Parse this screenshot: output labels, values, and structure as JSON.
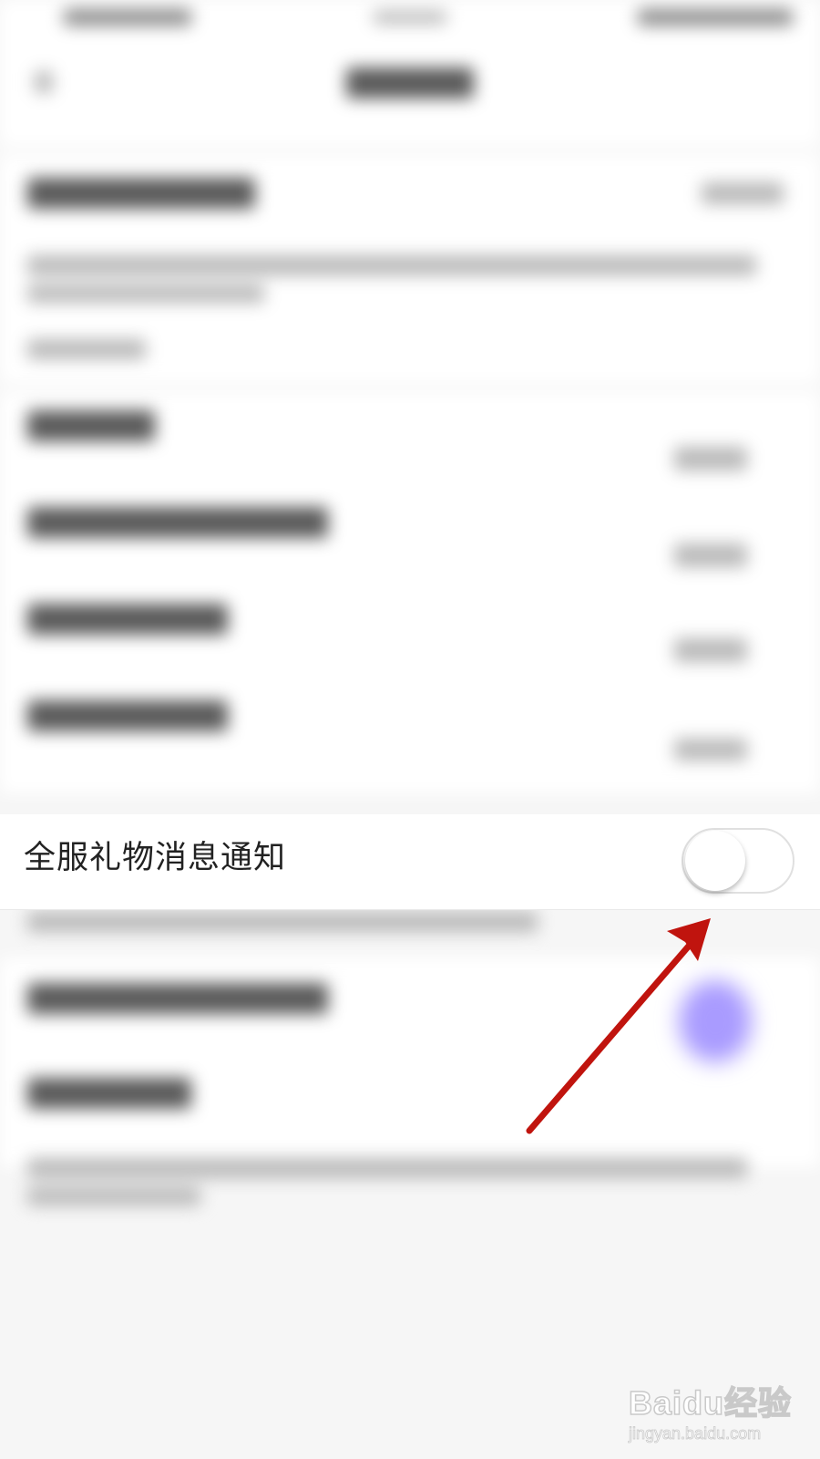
{
  "setting_row": {
    "label": "全服礼物消息通知",
    "toggle_on": false
  },
  "watermark": {
    "brand": "Baidu经验",
    "url": "jingyan.baidu.com"
  },
  "colors": {
    "arrow": "#c0140e",
    "accent_dot": "#a99bff",
    "row_background": "#ffffff",
    "page_background": "#f6f6f6"
  }
}
